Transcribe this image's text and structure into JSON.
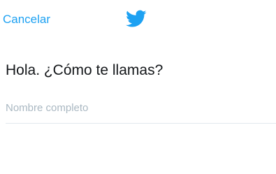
{
  "header": {
    "cancel_label": "Cancelar",
    "logo_icon": "twitter-bird-icon",
    "accent_color": "#1da1f2"
  },
  "main": {
    "heading": "Hola. ¿Cómo te llamas?",
    "name_field": {
      "value": "",
      "placeholder": "Nombre completo"
    }
  }
}
